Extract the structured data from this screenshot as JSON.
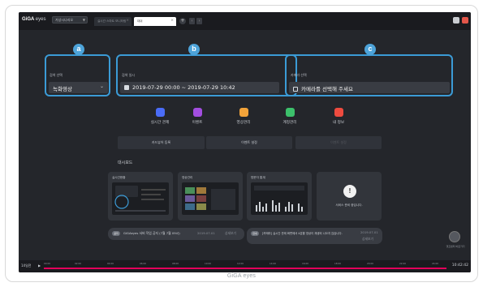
{
  "topbar": {
    "logo_brand": "GiGA",
    "logo_suffix": "eyes",
    "site_select": "가상시나리오",
    "tabs": [
      {
        "label": "실시간 스마트 모니터링",
        "active": false
      },
      {
        "label": "대쉬",
        "active": true
      }
    ]
  },
  "callouts": {
    "a": "a",
    "b": "b",
    "c": "c"
  },
  "search_type": {
    "label": "검색 선택",
    "value": "녹화영상"
  },
  "search_period": {
    "label": "검색 일시",
    "value": "2019-07-29 00:00 ~ 2019-07-29 10:42"
  },
  "camera_select": {
    "label": "카메라 선택",
    "placeholder": "카메라를 선택해 주세요"
  },
  "quick_icons": [
    {
      "label": "실시간 관제",
      "color": "#4a6cf7"
    },
    {
      "label": "이벤트",
      "color": "#a34ee0"
    },
    {
      "label": "영상관리",
      "color": "#f2a33a"
    },
    {
      "label": "계정관리",
      "color": "#3cc06b"
    },
    {
      "label": "내 정보",
      "color": "#ee4b3f"
    }
  ],
  "action_buttons": [
    "카드뷰어 등록",
    "이벤트 설정",
    "이벤트 설정"
  ],
  "dashboard": {
    "title": "대시보드",
    "cards": [
      "실시간현황",
      "영상관리",
      "방문자 통계"
    ],
    "notice_card_text": "서비스 준비 중입니다."
  },
  "notices": [
    {
      "tag": "공지",
      "text": "GiGAeyes 서버 작업 공지 (7월 7월 09시)",
      "date": "2019.07.01",
      "extra": "상세보기"
    },
    {
      "tag": "안내",
      "text": "[카메라] 실시간 관제 화면에서 4분할 영상이 재생되 나오지 않습니다.",
      "date": "2019.07.01",
      "extra": "상세보기"
    }
  ],
  "help_label": "헬프센터 바로가기",
  "timeline": {
    "label": "14일전",
    "ticks": [
      "00:00",
      "02:00",
      "04:00",
      "06:00",
      "08:00",
      "10:00",
      "12:00",
      "14:00",
      "16:00",
      "18:00",
      "20:00",
      "22:00",
      "24:00"
    ],
    "current_time": "10:42:42"
  },
  "footer_brand": "GiGA eyes",
  "colors": {
    "accent": "#3b9bd6",
    "timeline_bar": "#e3005b",
    "background": "#24262b"
  }
}
